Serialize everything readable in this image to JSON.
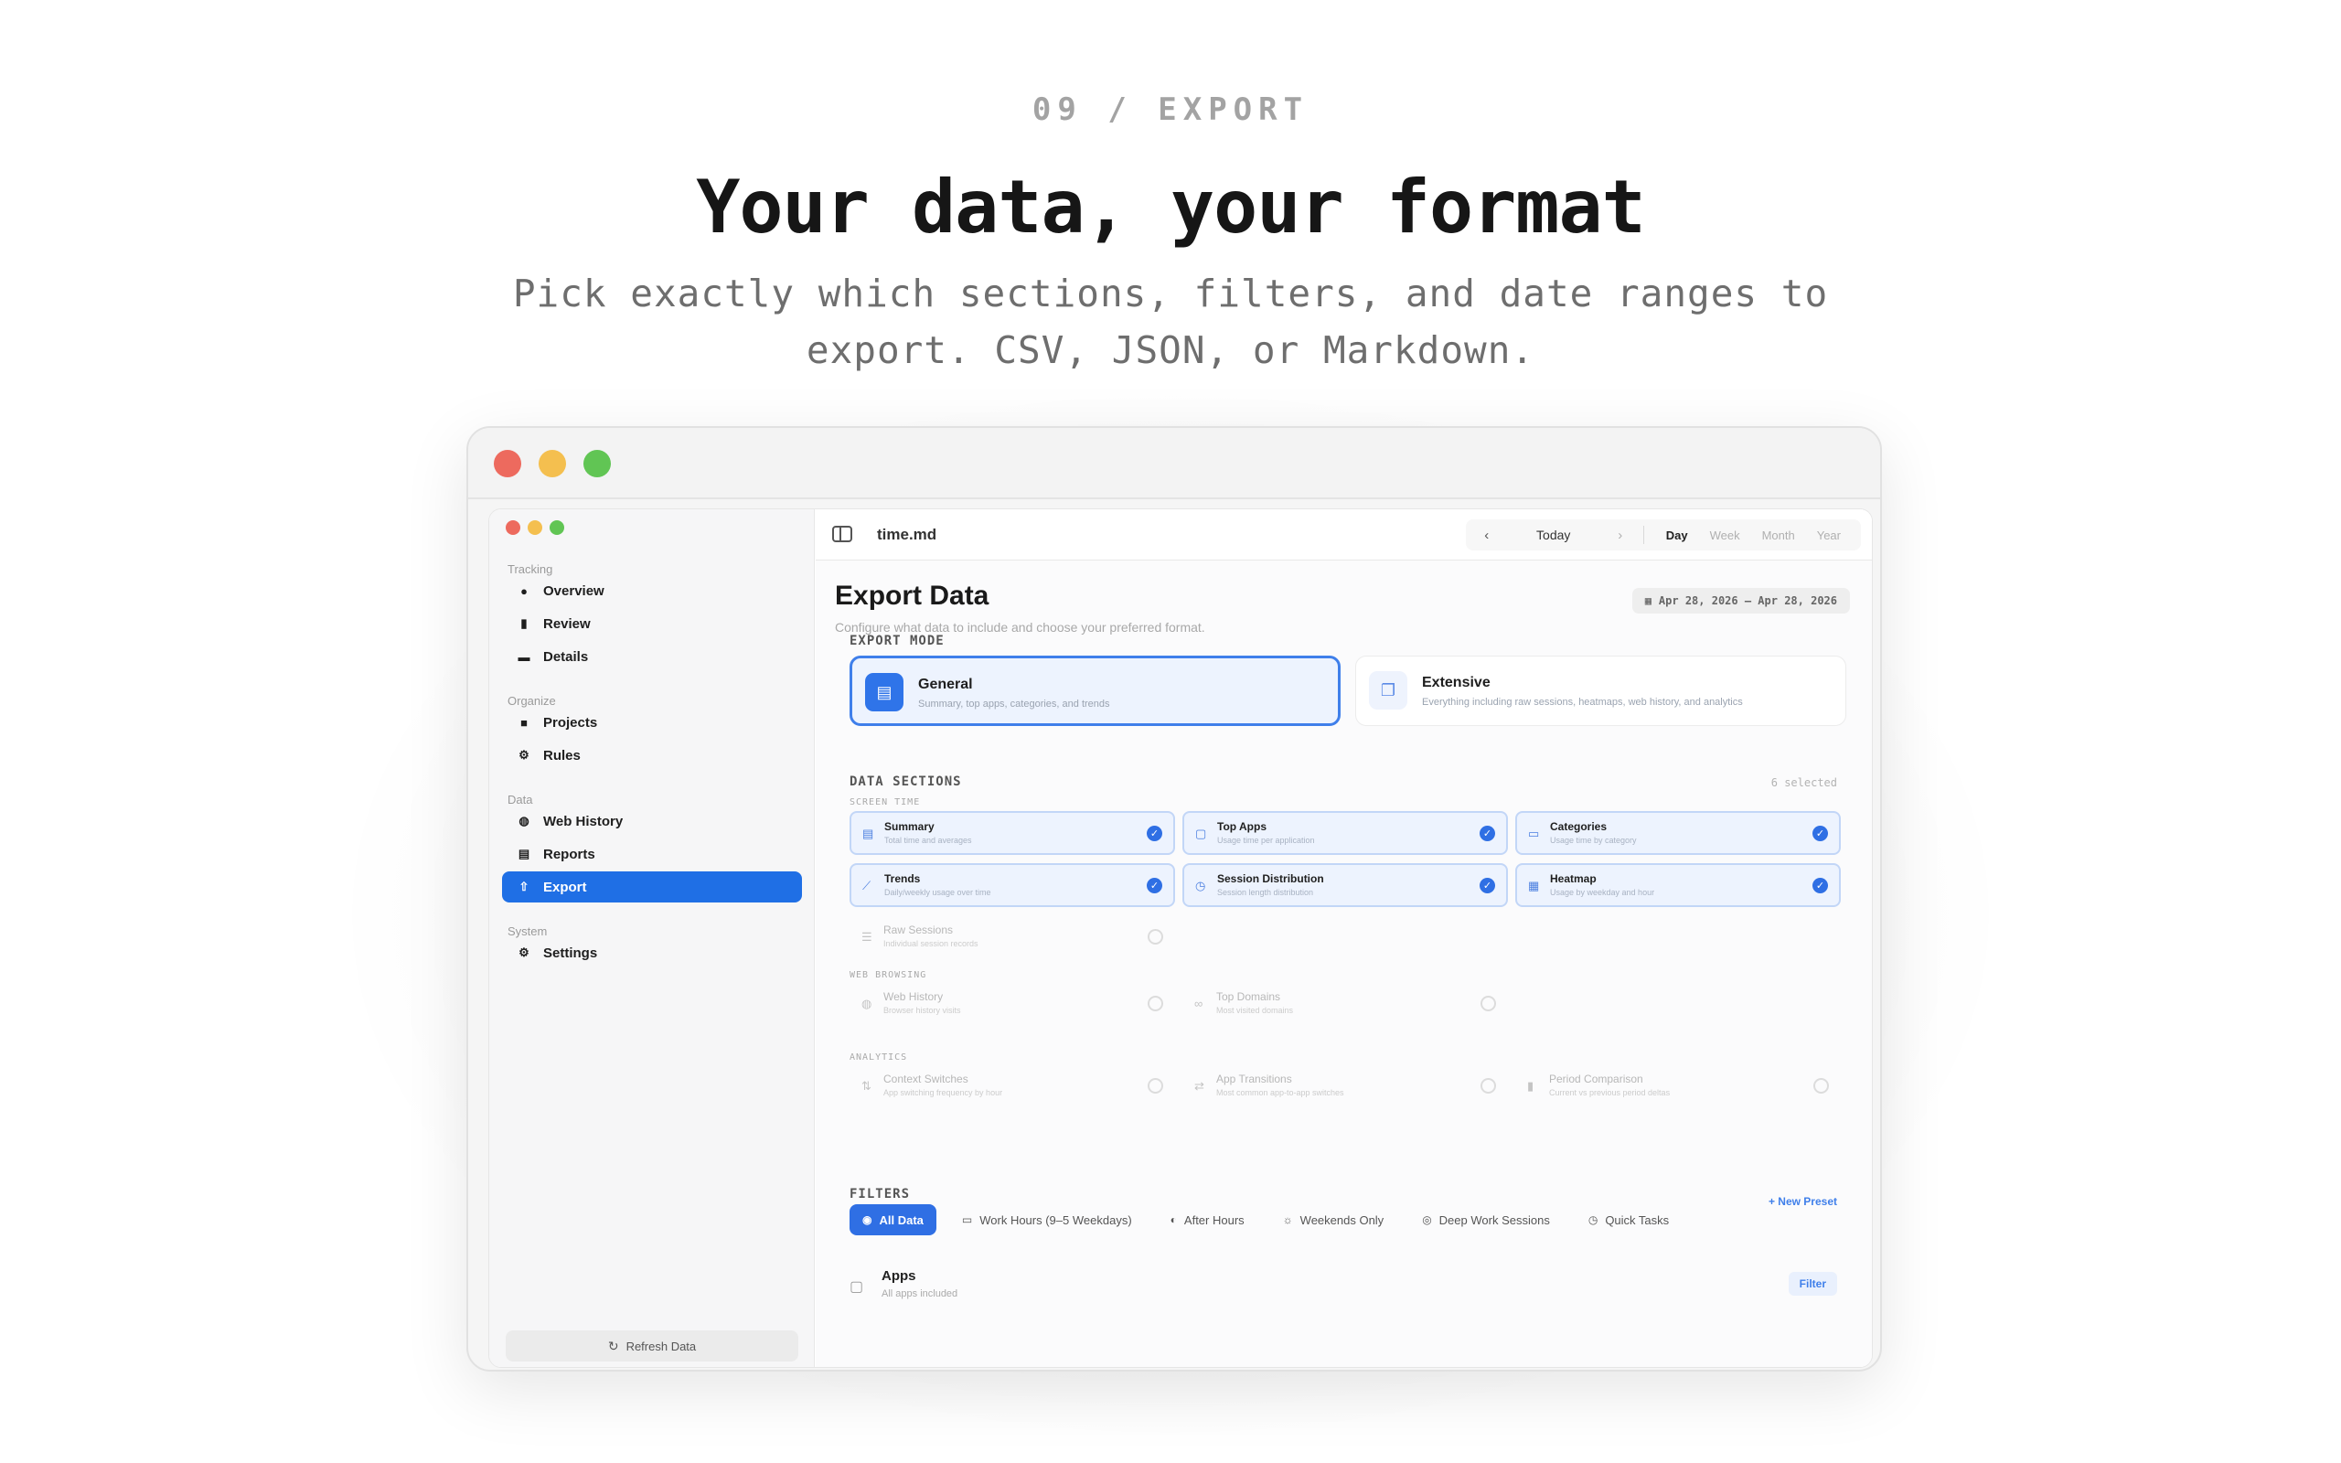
{
  "hero": {
    "eyebrow": "09 / EXPORT",
    "headline": "Your data, your format",
    "subhead": "Pick exactly which sections, filters, and date ranges to export. CSV, JSON, or Markdown."
  },
  "sidebar": {
    "sections": {
      "tracking": "Tracking",
      "organize": "Organize",
      "data": "Data",
      "system": "System"
    },
    "items": [
      {
        "label": "Overview",
        "icon": "clock-icon"
      },
      {
        "label": "Review",
        "icon": "bar-chart-icon"
      },
      {
        "label": "Details",
        "icon": "list-icon"
      },
      {
        "label": "Projects",
        "icon": "folder-icon"
      },
      {
        "label": "Rules",
        "icon": "rules-icon"
      },
      {
        "label": "Web History",
        "icon": "globe-icon"
      },
      {
        "label": "Reports",
        "icon": "document-icon"
      },
      {
        "label": "Export",
        "icon": "share-icon"
      },
      {
        "label": "Settings",
        "icon": "gear-icon"
      }
    ],
    "refresh_label": "Refresh Data",
    "active_color": "#1f6fe5"
  },
  "topbar": {
    "title": "time.md",
    "today": "Today",
    "ranges": [
      "Day",
      "Week",
      "Month",
      "Year"
    ],
    "active_range": "Day"
  },
  "page": {
    "title": "Export Data",
    "subtitle": "Configure what data to include and choose your preferred format.",
    "date_range": "Apr 28, 2026 – Apr 28, 2026"
  },
  "export_mode": {
    "label": "EXPORT MODE",
    "options": [
      {
        "title": "General",
        "desc": "Summary, top apps, categories, and trends",
        "selected": true
      },
      {
        "title": "Extensive",
        "desc": "Everything including raw sessions, heatmaps, web history, and analytics",
        "selected": false
      }
    ]
  },
  "data_sections": {
    "label": "DATA SECTIONS",
    "count": "6 selected",
    "groups": {
      "screen_time": "SCREEN TIME",
      "web_browsing": "WEB BROWSING",
      "analytics": "ANALYTICS"
    },
    "items": [
      {
        "title": "Summary",
        "desc": "Total time and averages",
        "checked": true
      },
      {
        "title": "Top Apps",
        "desc": "Usage time per application",
        "checked": true
      },
      {
        "title": "Categories",
        "desc": "Usage time by category",
        "checked": true
      },
      {
        "title": "Trends",
        "desc": "Daily/weekly usage over time",
        "checked": true
      },
      {
        "title": "Session Distribution",
        "desc": "Session length distribution",
        "checked": true
      },
      {
        "title": "Heatmap",
        "desc": "Usage by weekday and hour",
        "checked": true
      },
      {
        "title": "Raw Sessions",
        "desc": "Individual session records",
        "checked": false
      },
      {
        "title": "Web History",
        "desc": "Browser history visits",
        "checked": false
      },
      {
        "title": "Top Domains",
        "desc": "Most visited domains",
        "checked": false
      },
      {
        "title": "Context Switches",
        "desc": "App switching frequency by hour",
        "checked": false
      },
      {
        "title": "App Transitions",
        "desc": "Most common app-to-app switches",
        "checked": false
      },
      {
        "title": "Period Comparison",
        "desc": "Current vs previous period deltas",
        "checked": false
      }
    ]
  },
  "filters": {
    "label": "FILTERS",
    "new_preset": "+ New Preset",
    "chips": [
      {
        "label": "All Data",
        "active": true
      },
      {
        "label": "Work Hours (9–5 Weekdays)",
        "active": false
      },
      {
        "label": "After Hours",
        "active": false
      },
      {
        "label": "Weekends Only",
        "active": false
      },
      {
        "label": "Deep Work Sessions",
        "active": false
      },
      {
        "label": "Quick Tasks",
        "active": false
      }
    ]
  },
  "apps": {
    "title": "Apps",
    "desc": "All apps included",
    "filter_label": "Filter"
  },
  "colors": {
    "accent": "#2f6fe4",
    "window_red": "#ed6a5e",
    "window_yellow": "#f4bf4f",
    "window_green": "#61c554"
  }
}
